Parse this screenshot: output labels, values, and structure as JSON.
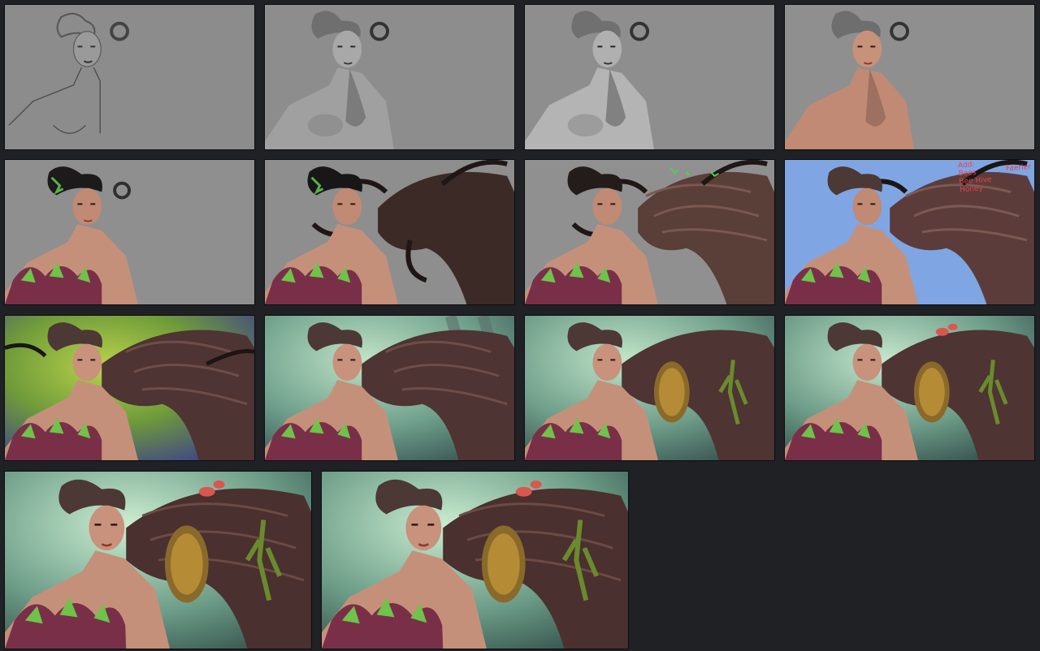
{
  "canvas": {
    "background": "#1f2124"
  },
  "annotations": {
    "add_list": [
      "Add:",
      "Bees",
      "Bee Hive",
      "Honey"
    ],
    "side_note": "Faerier",
    "ink_color": "#e0454f"
  },
  "panels": [
    {
      "stage": "sketch",
      "palette": "grayscale"
    },
    {
      "stage": "grayscale-shading",
      "palette": "grayscale"
    },
    {
      "stage": "grayscale-refined",
      "palette": "grayscale"
    },
    {
      "stage": "skin-tone",
      "palette": "warm"
    },
    {
      "stage": "leaf-dress",
      "palette": "warm-green"
    },
    {
      "stage": "tree-blocking",
      "palette": "brown"
    },
    {
      "stage": "tree-texture",
      "palette": "brown-green"
    },
    {
      "stage": "sky-background",
      "palette": "blue",
      "background_color": "#7fa6e3"
    },
    {
      "stage": "color-gradient",
      "palette": "green-purple"
    },
    {
      "stage": "forest-mist",
      "palette": "teal"
    },
    {
      "stage": "beehive-and-grasshopper",
      "palette": "teal"
    },
    {
      "stage": "mushrooms-added",
      "palette": "teal"
    },
    {
      "stage": "final",
      "palette": "teal"
    },
    {
      "stage": "final-variant",
      "palette": "teal"
    }
  ]
}
